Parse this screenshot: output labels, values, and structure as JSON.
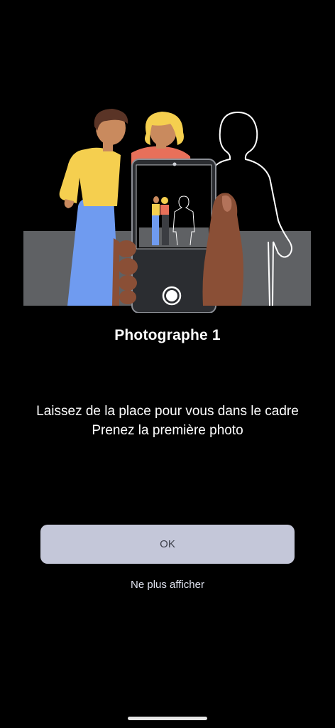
{
  "dialog": {
    "title": "Photographe 1",
    "instruction_line1": "Laissez de la place pour vous dans le cadre",
    "instruction_line2": "Prenez la première photo",
    "ok_label": "OK",
    "dont_show_label": "Ne plus afficher"
  },
  "colors": {
    "background": "#000000",
    "button_bg": "#c4c7d9",
    "button_text": "#3c3f4a",
    "scene_wall": "#5f6164",
    "person_yellow": "#f5cf4f",
    "person_blue": "#6f9bf0",
    "person_red": "#e8705a",
    "skin_tone": "#c98a5e",
    "hand_tone": "#8a4f36"
  },
  "illustration": {
    "icon": "group-photo-illustration"
  }
}
